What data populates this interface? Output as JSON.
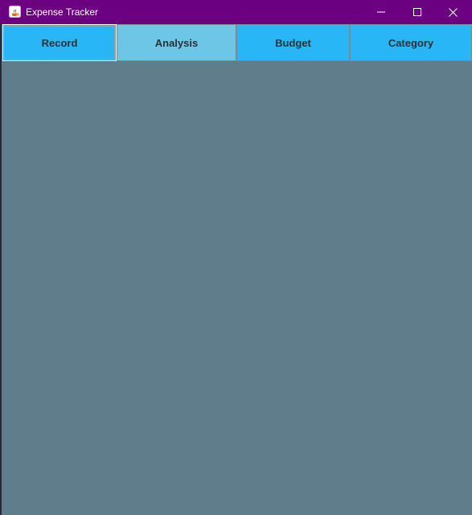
{
  "window": {
    "title": "Expense Tracker",
    "icon": "java-app-icon",
    "controls": {
      "minimize_icon": "minimize-icon",
      "maximize_icon": "maximize-icon",
      "close_icon": "close-icon"
    }
  },
  "tabs": [
    {
      "label": "Record"
    },
    {
      "label": "Analysis"
    },
    {
      "label": "Budget"
    },
    {
      "label": "Category"
    }
  ],
  "colors": {
    "titlebar": "#6b0080",
    "tab": "#29b6f6",
    "tab_hover": "#6ec6e6",
    "content_background": "#607d8b",
    "tab_text": "#263238"
  }
}
